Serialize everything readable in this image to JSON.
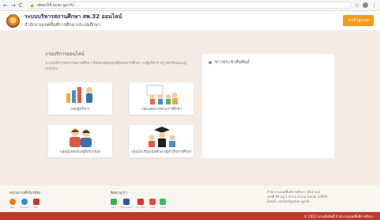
{
  "browser": {
    "url": "obec04.ocsc.go.th/...",
    "nav_back": "←",
    "nav_forward": "→",
    "nav_reload": "C"
  },
  "header": {
    "title": "ระบบบริหารสถานศึกษา สพ.32 ออนไลน์",
    "subtitle": "สำนักงานเขตพื้นที่การศึกษาประถมศึกษา",
    "login": "เข้าสู่ระบบ"
  },
  "services": {
    "title": "งานบริการออนไลน์",
    "description": "ระบบบริหารจัดการสถานศึกษา ที่ครอบคลุมทุกมิติของการศึกษา แก่ผู้บริหาร ครู นักเรียนและผู้ปกครอง",
    "cards": [
      {
        "label": "กลุ่มผู้บริหาร"
      },
      {
        "label": "กลุ่มบุคลากรทางการศึกษา"
      },
      {
        "label": "กลุ่มผู้ปกครอง/ผู้ที่เกี่ยวข้อง"
      },
      {
        "label": "กลุ่มนักเรียน/นักศึกษา/ผู้สำเร็จการศึกษา"
      }
    ]
  },
  "news": {
    "title": "ข่าวประชาสัมพันธ์"
  },
  "footer": {
    "col1_title": "หน่วยงานที่เกี่ยวข้อง",
    "col1_items": [
      "สพฐ.",
      "กระทรวง",
      "สพท."
    ],
    "col2_title": "ติดตามเรา",
    "col2_items": [
      "Line",
      "Facebook",
      "YouTube",
      "Help",
      "Chat"
    ],
    "contact_lines": [
      "สำนักงานเขตพื้นที่การศึกษา: 043-xxx",
      "เลขที่ 99 หมู่ 1 ตำบล อำเภอ จังหวัด 32000",
      "Email: contact@obec.go.th"
    ]
  },
  "bottom": {
    "copyright": "© 2022 สงวนลิขสิทธิ์ สำนักงานเขตพื้นที่การศึกษา"
  }
}
